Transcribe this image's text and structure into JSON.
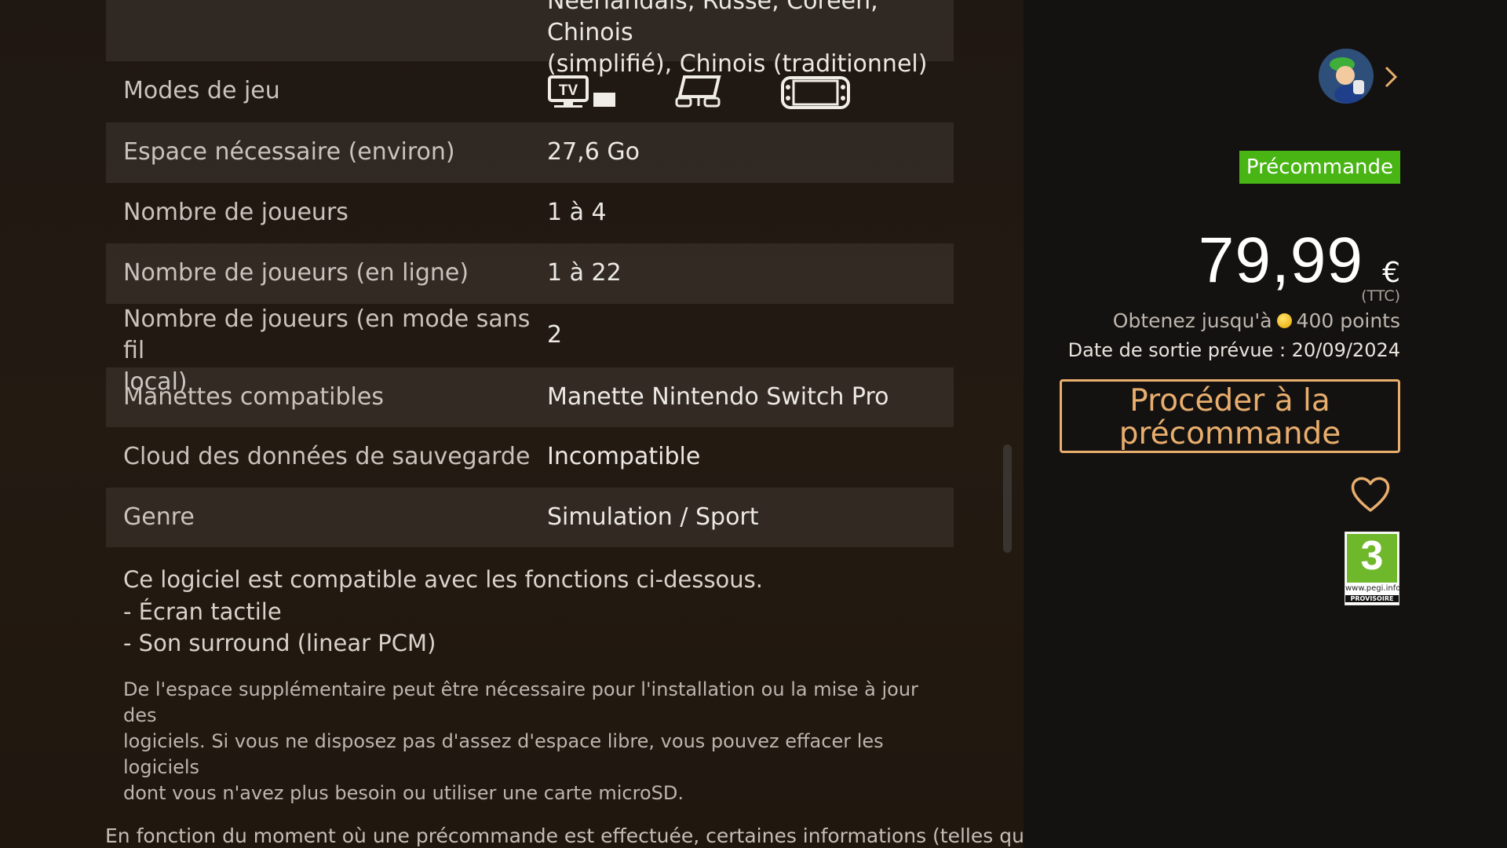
{
  "table": {
    "languages_value_line1": "Néerlandais, Russe, Coréen, Chinois",
    "languages_value_line2": "(simplifié), Chinois (traditionnel)",
    "rows": [
      {
        "label": "Modes de jeu",
        "value": ""
      },
      {
        "label": "Espace nécessaire (environ)",
        "value": "27,6 Go"
      },
      {
        "label": "Nombre de joueurs",
        "value": "1 à 4"
      },
      {
        "label": "Nombre de joueurs (en ligne)",
        "value": "1 à 22"
      },
      {
        "label_line1": "Nombre de joueurs (en mode sans fil",
        "label_line2": "local)",
        "value": "2"
      },
      {
        "label": "Manettes compatibles",
        "value": "Manette Nintendo Switch Pro"
      },
      {
        "label": "Cloud des données de sauvegarde",
        "value": "Incompatible"
      },
      {
        "label": "Genre",
        "value": "Simulation / Sport"
      }
    ],
    "play_modes": {
      "tv": {
        "icon": "tv-mode-icon",
        "text": "TV"
      },
      "tabletop": {
        "icon": "tabletop-mode-icon"
      },
      "handheld": {
        "icon": "handheld-mode-icon"
      }
    }
  },
  "features": {
    "intro": "Ce logiciel est compatible avec les fonctions ci-dessous.",
    "items": [
      "- Écran tactile",
      "- Son surround (linear PCM)"
    ]
  },
  "note": {
    "line1": "De l'espace supplémentaire peut être nécessaire pour l'installation ou la mise à jour des",
    "line2": "logiciels. Si vous ne disposez pas d'assez d'espace libre, vous pouvez effacer les logiciels",
    "line3": "dont vous n'avez plus besoin ou utiliser une carte microSD."
  },
  "disclaimer": "En fonction du moment où une précommande est effectuée, certaines informations (telles que",
  "sidebar": {
    "avatar": {
      "icon": "user-avatar-icon"
    },
    "chevron": {
      "icon": "chevron-right-icon"
    },
    "badge": "Précommande",
    "price": "79,99",
    "currency": "€",
    "tax_note": "(TTC)",
    "points_prefix": "Obtenez jusqu'à",
    "points_suffix": "400 points",
    "release": "Date de sortie prévue : 20/09/2024",
    "preorder_button_line1": "Procéder à la",
    "preorder_button_line2": "précommande",
    "wishlist": {
      "icon": "heart-icon"
    },
    "rating": {
      "icon": "pegi-rating-icon",
      "number": "3",
      "site": "www.pegi.info",
      "provisional": "PROVISOIRE"
    }
  },
  "colors": {
    "accent_orange": "#e8ae6e",
    "badge_green": "#49b514",
    "pegi_green": "#6fb82b"
  }
}
